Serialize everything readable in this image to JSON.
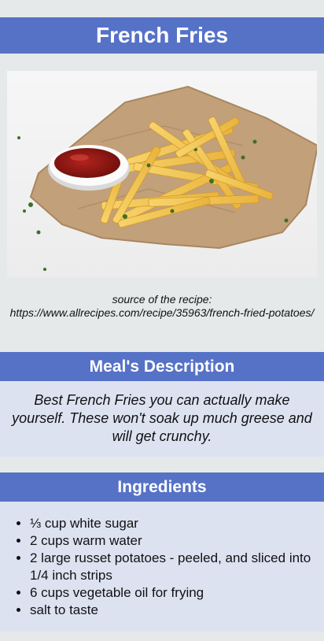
{
  "recipe": {
    "title": "French Fries",
    "photo_alt": "French Fries",
    "source_prefix": "source of the recipe:",
    "source_url": "https://www.allrecipes.com/recipe/35963/french-fried-potatoes/"
  },
  "description": {
    "heading": "Meal's Description",
    "text": "Best French Fries you can actually make yourself. These won't soak up much greese and will get crunchy."
  },
  "ingredients": {
    "heading": "Ingredients",
    "items": [
      "⅓ cup white sugar",
      "2 cups warm water",
      "2 large russet potatoes - peeled, and sliced into 1/4 inch strips",
      "6 cups vegetable oil for frying",
      "salt to taste"
    ]
  },
  "colors": {
    "header_bg": "#5672c7",
    "section_bg": "#dde2f1",
    "page_bg": "#e6e9e9"
  }
}
